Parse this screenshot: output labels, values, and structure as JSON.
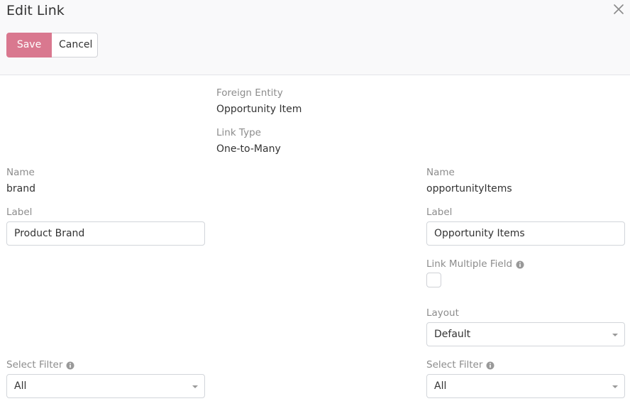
{
  "dialog": {
    "title": "Edit Link",
    "close_icon": "close-icon"
  },
  "toolbar": {
    "save_label": "Save",
    "cancel_label": "Cancel",
    "save_color": "#d9788f"
  },
  "center": {
    "foreign_entity_label": "Foreign Entity",
    "foreign_entity_value": "Opportunity Item",
    "link_type_label": "Link Type",
    "link_type_value": "One-to-Many"
  },
  "left": {
    "name_label": "Name",
    "name_value": "brand",
    "label_label": "Label",
    "label_value": "Product Brand",
    "select_filter_label": "Select Filter",
    "select_filter_value": "All"
  },
  "right": {
    "name_label": "Name",
    "name_value": "opportunityItems",
    "label_label": "Label",
    "label_value": "Opportunity Items",
    "link_multiple_label": "Link Multiple Field",
    "link_multiple_checked": false,
    "layout_label": "Layout",
    "layout_value": "Default",
    "select_filter_label": "Select Filter",
    "select_filter_value": "All"
  }
}
